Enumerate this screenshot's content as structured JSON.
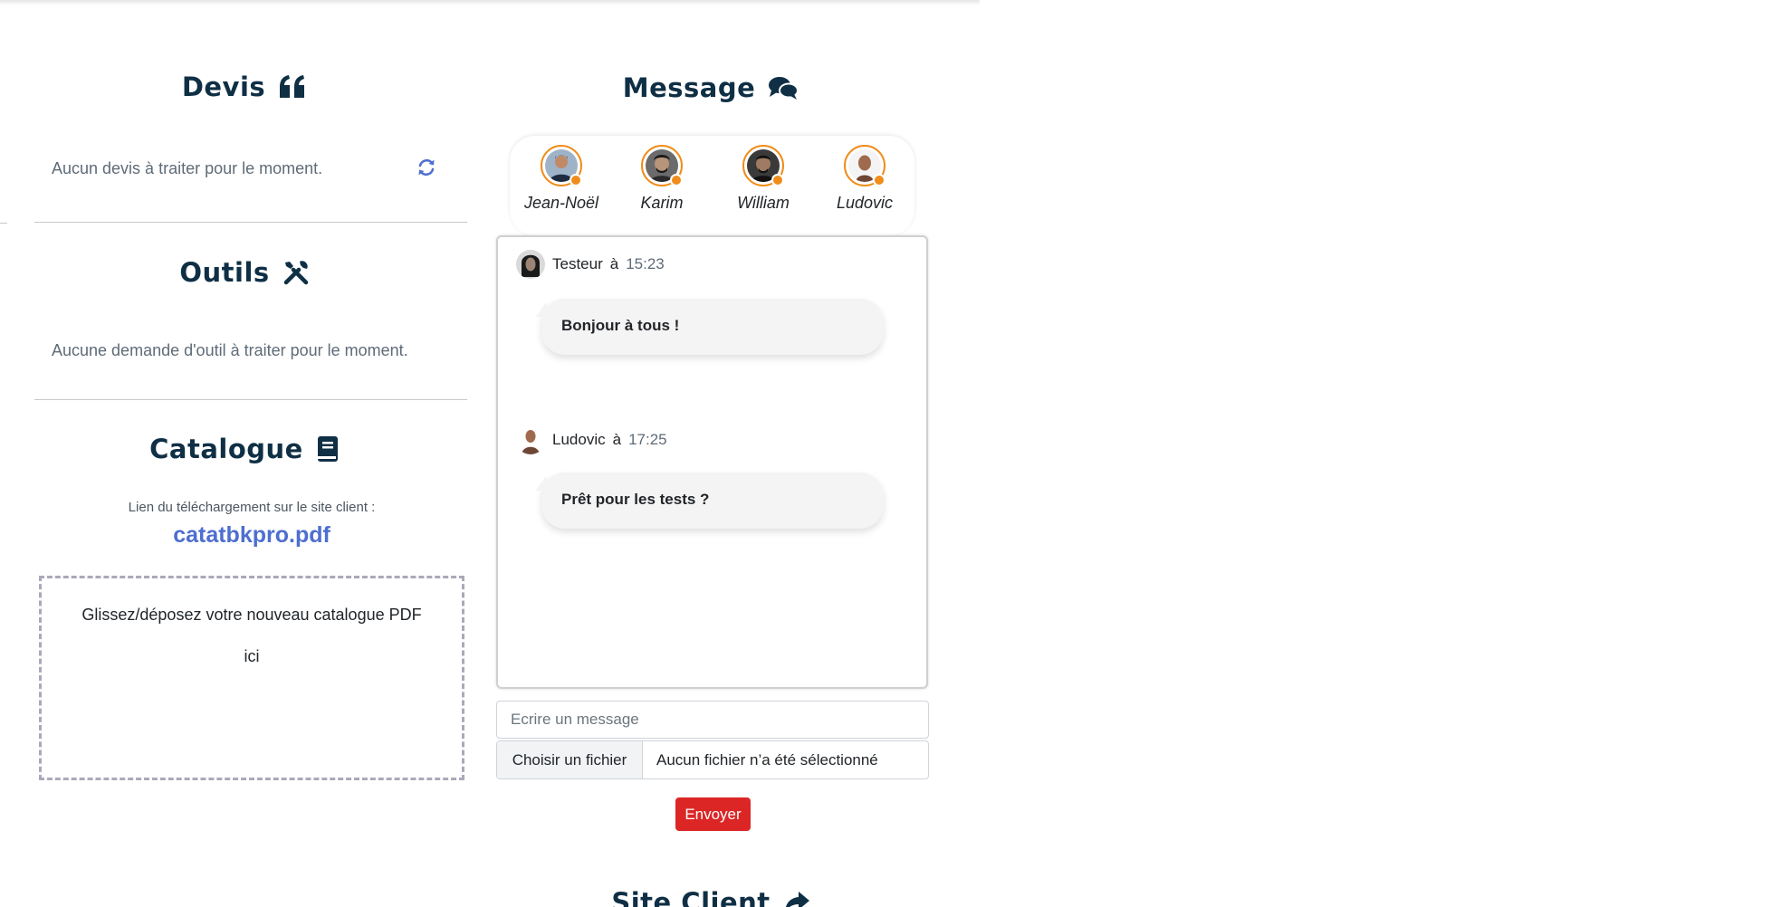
{
  "left": {
    "devis": {
      "title": "Devis",
      "empty_text": "Aucun devis à traiter pour le moment."
    },
    "outils": {
      "title": "Outils",
      "empty_text": "Aucune demande d'outil à traiter pour le moment."
    },
    "catalogue": {
      "title": "Catalogue",
      "download_label": "Lien du téléchargement sur le site client :",
      "file_link": "catatbkpro.pdf",
      "dropzone_line1": "Glissez/déposez votre nouveau catalogue PDF",
      "dropzone_line2": "ici"
    }
  },
  "message": {
    "title": "Message",
    "contacts": [
      {
        "name": "Jean-Noël",
        "status": "online"
      },
      {
        "name": "Karim",
        "status": "online"
      },
      {
        "name": "William",
        "status": "online"
      },
      {
        "name": "Ludovic",
        "status": "online"
      }
    ],
    "messages": [
      {
        "author": "Testeur",
        "sep": "à",
        "time": "15:23",
        "text": "Bonjour à tous !"
      },
      {
        "author": "Ludovic",
        "sep": "à",
        "time": "17:25",
        "text": "Prêt pour les tests ?"
      }
    ],
    "input_placeholder": "Ecrire un message",
    "file_button": "Choisir un fichier",
    "file_status": "Aucun fichier n’a été sélectionné",
    "send_button": "Envoyer"
  },
  "site_client": {
    "title": "Site Client"
  },
  "colors": {
    "heading": "#0f2f45",
    "accent_link": "#4e6ed0",
    "status_dot": "#f08c1a",
    "send_button": "#dc2626"
  },
  "icons": {
    "devis": "quote-icon",
    "outils": "tools-icon",
    "catalogue": "book-icon",
    "message": "chat-bubbles-icon",
    "site_client": "share-arrow-icon",
    "refresh": "refresh-icon"
  }
}
